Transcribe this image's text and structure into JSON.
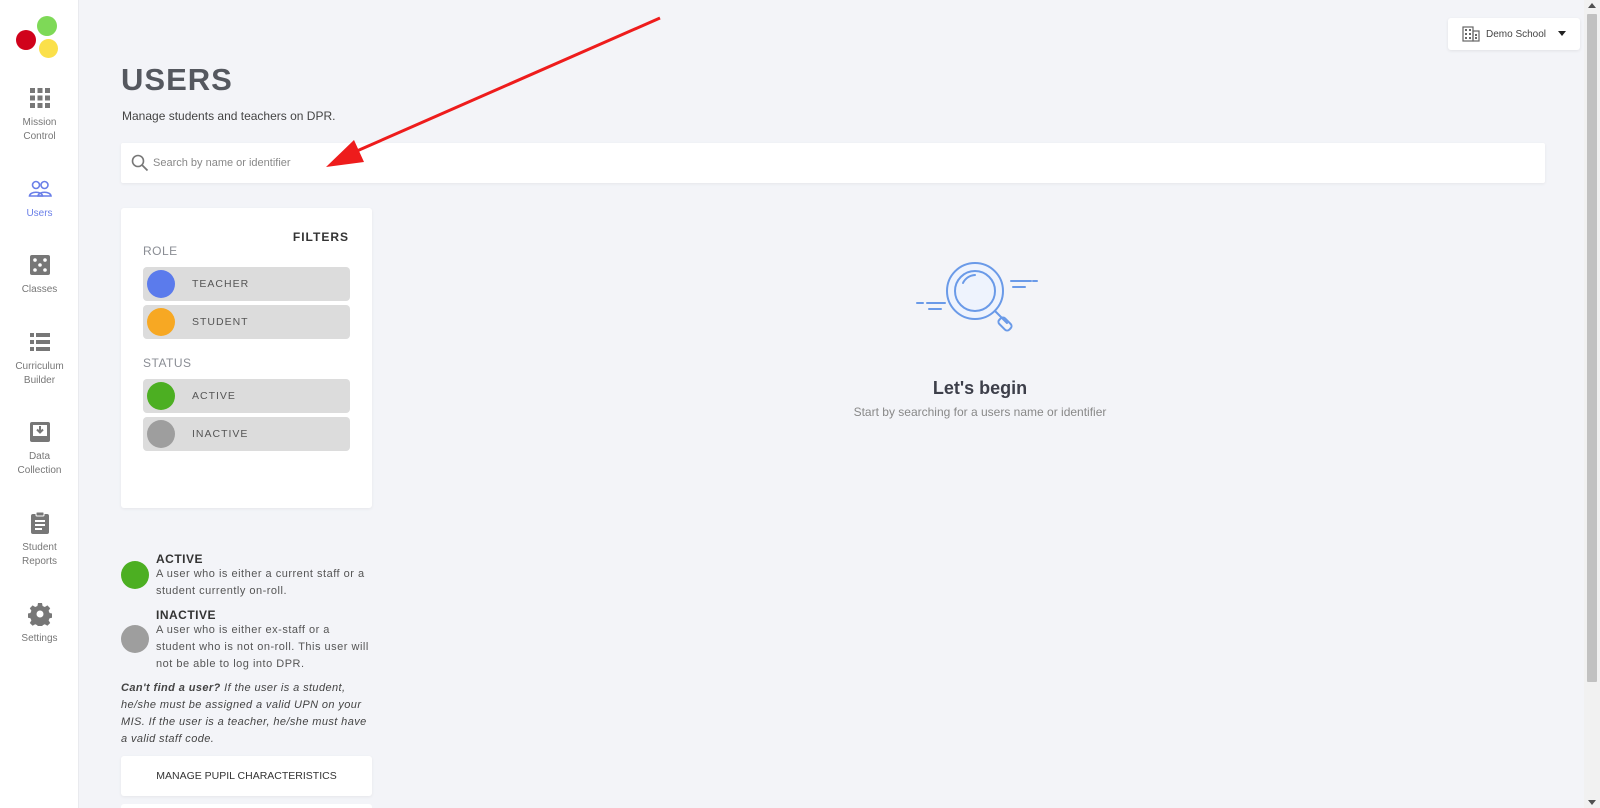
{
  "app": {
    "brand_colors": [
      "#d0021b",
      "#7ed957",
      "#fbe04a"
    ]
  },
  "sidebar": {
    "items": [
      {
        "label": "Mission Control",
        "icon": "grid-icon",
        "active": false
      },
      {
        "label": "Users",
        "icon": "users-icon",
        "active": true
      },
      {
        "label": "Classes",
        "icon": "dice-icon",
        "active": false
      },
      {
        "label": "Curriculum Builder",
        "icon": "list-icon",
        "active": false
      },
      {
        "label": "Data Collection",
        "icon": "inbox-download-icon",
        "active": false
      },
      {
        "label": "Student Reports",
        "icon": "clipboard-icon",
        "active": false
      },
      {
        "label": "Settings",
        "icon": "gear-icon",
        "active": false
      }
    ]
  },
  "header": {
    "school": "Demo School",
    "school_icon": "building-icon"
  },
  "page": {
    "title": "USERS",
    "subtitle": "Manage students and teachers on DPR."
  },
  "search": {
    "placeholder": "Search by name or identifier",
    "value": ""
  },
  "filters": {
    "title": "FILTERS",
    "role_label": "ROLE",
    "roles": [
      {
        "label": "TEACHER",
        "color": "#5b7bec"
      },
      {
        "label": "STUDENT",
        "color": "#f7a823"
      }
    ],
    "status_label": "STATUS",
    "statuses": [
      {
        "label": "ACTIVE",
        "color": "#4caf22"
      },
      {
        "label": "INACTIVE",
        "color": "#9e9e9e"
      }
    ]
  },
  "legend": [
    {
      "title": "ACTIVE",
      "desc": "A user who is either a current staff or a student currently on-roll.",
      "color": "#4caf22"
    },
    {
      "title": "INACTIVE",
      "desc": "A user who is either ex-staff or a student who is not on-roll. This user will not be able to log into DPR.",
      "color": "#9e9e9e"
    }
  ],
  "note": {
    "bold": "Can't find a user?",
    "text": " If the user is a student, he/she must be assigned a valid UPN on your MIS. If the user is a teacher, he/she must have a valid staff code."
  },
  "manage_button": "MANAGE PUPIL CHARACTERISTICS",
  "empty_state": {
    "title": "Let's begin",
    "subtitle": "Start by searching for a users name or identifier",
    "icon": "magnifier-illustration"
  },
  "annotation": {
    "color": "#ee1c1c"
  }
}
